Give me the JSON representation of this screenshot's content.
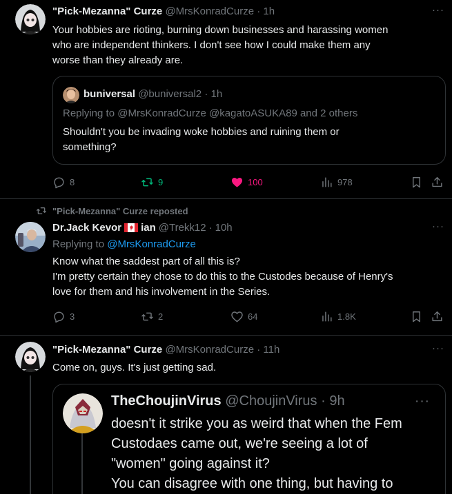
{
  "post1": {
    "name": "\"Pick-Mezanna\" Curze",
    "handle": "@MrsKonradCurze",
    "time": "1h",
    "text_line1": "Your hobbies are rioting, burning down businesses and harassing women",
    "text_line2": "who are independent thinkers. I don't see how I could make them any",
    "text_line3": "worse than they already are.",
    "quote": {
      "name": "buniversal",
      "handle": "@buniversal2",
      "time": "1h",
      "replying_prefix": "Replying to",
      "replying_to": "@MrsKonradCurze @kagatoASUKA89 and 2 others",
      "text_line1": "Shouldn't you be invading woke hobbies and ruining them or",
      "text_line2": "something?"
    },
    "replies": "8",
    "reposts": "9",
    "likes": "100",
    "views": "978"
  },
  "post2": {
    "repost_label": "\"Pick-Mezanna\" Curze reposted",
    "name_a": "Dr.Jack Kevor",
    "name_b": "ian",
    "handle": "@Trekk12",
    "time": "10h",
    "replying_prefix": "Replying to",
    "replying_to": "@MrsKonradCurze",
    "text_line1": "Know what the saddest part of all this is?",
    "text_line2": "I'm pretty certain they chose to do this to the Custodes because of Henry's",
    "text_line3": "love for them and his involvement in the Series.",
    "replies": "3",
    "reposts": "2",
    "likes": "64",
    "views": "1.8K"
  },
  "post3": {
    "name": "\"Pick-Mezanna\" Curze",
    "handle": "@MrsKonradCurze",
    "time": "11h",
    "text": "Come on, guys. It's just getting sad.",
    "quote": {
      "name": "TheChoujinVirus",
      "handle": "@ChoujinVirus",
      "time": "9h",
      "text_line1": "doesn't it strike you as weird that when the Fem",
      "text_line2": "Custodaes came out, we're seeing a lot of",
      "text_line3": "\"women\" going against it?",
      "text_line4": "You can disagree with one thing, but having to"
    }
  },
  "separator": "·",
  "more_label": "···",
  "colors": {
    "accent": "#1d9bf0",
    "repost_green": "#00ba7c",
    "like_pink": "#f91880",
    "muted": "#71767b"
  }
}
